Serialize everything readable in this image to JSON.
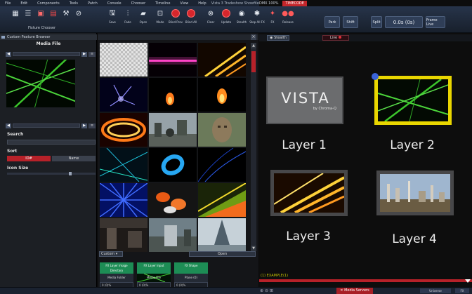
{
  "menu": {
    "items": [
      "File",
      "Edit",
      "Components",
      "Tools",
      "Patch",
      "Console",
      "Chooser",
      "Timeline",
      "View",
      "Help"
    ],
    "title": "Vista 3 Tradeshow Showfile*",
    "dmx": "DMX 100%",
    "time": "TIMECODE"
  },
  "toolbar": {
    "fixture_chooser": "Fixture Chooser",
    "buttons": [
      {
        "label": "Save",
        "icon": "save-icon"
      },
      {
        "label": "Fade",
        "icon": "sliders-icon"
      },
      {
        "label": "Open",
        "icon": "folder-icon"
      },
      {
        "label": "Mode",
        "icon": "mode-icon"
      },
      {
        "label": "Blind Prev",
        "icon": "record-icon"
      },
      {
        "label": "Blind All",
        "icon": "record-icon"
      },
      {
        "label": "Clear",
        "icon": "clear-icon"
      },
      {
        "label": "Update",
        "icon": "record-icon"
      },
      {
        "label": "Stealth",
        "icon": "eye-icon"
      },
      {
        "label": "Stop All FX",
        "icon": "stop-icon"
      },
      {
        "label": "FX",
        "icon": "fx-icon"
      },
      {
        "label": "Release",
        "icon": "release-icon"
      }
    ],
    "right": [
      {
        "label": "Park"
      },
      {
        "label": "Shift"
      },
      {
        "label": "Split"
      },
      {
        "label": "0.0s (0s)"
      },
      {
        "label": "Frame Live"
      }
    ]
  },
  "left": {
    "title": "Custom Feature Browser",
    "media_file": "Media File",
    "search_label": "Search",
    "sort_label": "Sort",
    "sort_options": [
      "ID#",
      "Name"
    ],
    "icon_size_label": "Icon Size"
  },
  "middle": {
    "custom_label": "Custom",
    "open_label": "Open",
    "pools": [
      {
        "top": "FX Layer Image Directory",
        "bottom": "Media Folder",
        "value": "0 (0)%"
      },
      {
        "top": "FX Layer Input",
        "bottom": "Media File",
        "value": "0 (0)%"
      },
      {
        "top": "FX Shape",
        "bottom": "Plane (0)",
        "value": "0 (0)%"
      }
    ]
  },
  "right": {
    "stealth_tab": "Stealth",
    "live_tab": "Live",
    "vista_brand": "VISTA",
    "vista_sub": "by Chroma-Q",
    "layers": [
      "Layer 1",
      "Layer 2",
      "Layer 3",
      "Layer 4"
    ],
    "status": "(1) EXAMPLE(1)"
  },
  "bottom": {
    "media_servers": "Media Servers",
    "universe": "Universe",
    "right_label": "FX"
  },
  "colors": {
    "accent_red": "#b72129",
    "selection_yellow": "#e9d600",
    "pool_green": "#1d8d55"
  }
}
